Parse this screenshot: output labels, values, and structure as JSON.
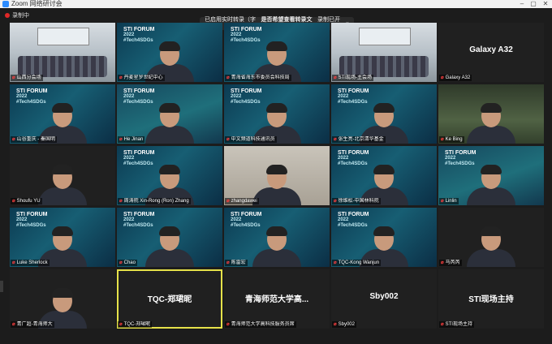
{
  "window": {
    "title": "Zoom 网络研讨会"
  },
  "recording": {
    "label": "录制中"
  },
  "banner": {
    "text1": "已启用实时转录（字幕）",
    "text2": "是否希望查看转录文字？",
    "text3": "录制已开启",
    "close": "×"
  },
  "tiles": [
    {
      "name": "山西分会场",
      "bg": "room"
    },
    {
      "name": "丹麦星罗世纪中心",
      "bg": "sti"
    },
    {
      "name": "青海省海东市委员会科技局",
      "bg": "sti"
    },
    {
      "name": "STI现场-主会场",
      "bg": "room2"
    },
    {
      "name": "Galaxy A32",
      "bg": "dark",
      "center": "Galaxy A32"
    },
    {
      "name": "山谷重庆 - 秦国明",
      "bg": "sti"
    },
    {
      "name": "He Jinan",
      "bg": "sti2"
    },
    {
      "name": "中文频道科技通讯员",
      "bg": "sti"
    },
    {
      "name": "张生亮-北京清华基金",
      "bg": "sti"
    },
    {
      "name": "Ke Bing",
      "bg": "plant"
    },
    {
      "name": "Shoufu YU",
      "bg": "dark"
    },
    {
      "name": "周涛院 Xin-Rong (Ron) Zhang",
      "bg": "sti"
    },
    {
      "name": "zhangdawei",
      "bg": "office"
    },
    {
      "name": "徐维松-中国林科院",
      "bg": "sti"
    },
    {
      "name": "Linlin",
      "bg": "sti2"
    },
    {
      "name": "Luke Sherlock",
      "bg": "sti"
    },
    {
      "name": "Chao",
      "bg": "sti"
    },
    {
      "name": "陈雷宏",
      "bg": "sti"
    },
    {
      "name": "TQC-Kong Wanjun",
      "bg": "sti"
    },
    {
      "name": "马芮芮",
      "bg": "dark"
    },
    {
      "name": "青广超-青海师大",
      "bg": "dark"
    },
    {
      "name": "TQC-郑珺昵",
      "bg": "dark",
      "center": "TQC-郑珺昵"
    },
    {
      "name": "青海师范大学高科技服务员席",
      "bg": "dark",
      "center": "青海师范大学高..."
    },
    {
      "name": "Sby002",
      "bg": "dark",
      "center": "Sby002"
    },
    {
      "name": "STI现场主持",
      "bg": "dark",
      "center": "STI现场主持"
    }
  ],
  "sti_logo": {
    "line1": "STI FORUM",
    "line2": "2022",
    "line3": "#Tech4SDGs"
  },
  "active_speaker": "TQC-郑珺昵"
}
